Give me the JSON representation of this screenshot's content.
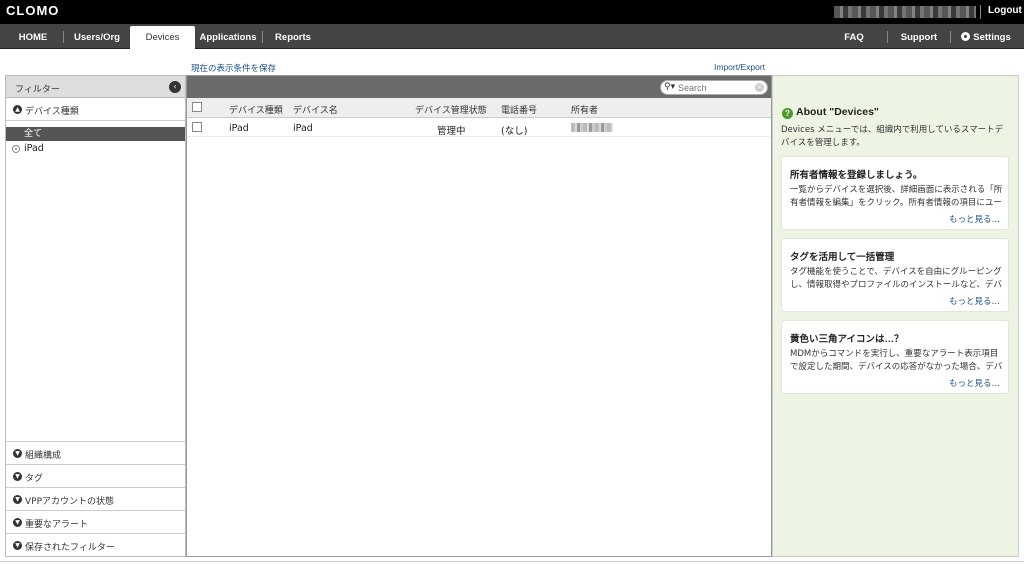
{
  "app": {
    "logo": "CLOMO",
    "logout": "Logout"
  },
  "nav": {
    "items": [
      {
        "label": "HOME"
      },
      {
        "label": "Users/Org"
      },
      {
        "label": "Devices",
        "active": true
      },
      {
        "label": "Applications"
      },
      {
        "label": "Reports"
      }
    ],
    "right": [
      {
        "label": "FAQ"
      },
      {
        "label": "Support"
      },
      {
        "label": "Settings",
        "icon": "gear-icon"
      }
    ]
  },
  "links": {
    "save_view": "現在の表示条件を保存",
    "import_export": "Import/Export"
  },
  "filter": {
    "title": "フィルター",
    "device_type_label": "デバイス種類",
    "options": [
      {
        "label": "全て",
        "selected": true
      },
      {
        "label": "iPad"
      }
    ],
    "sections": [
      {
        "label": "組織構成"
      },
      {
        "label": "タグ"
      },
      {
        "label": "VPPアカウントの状態"
      },
      {
        "label": "重要なアラート"
      },
      {
        "label": "保存されたフィルター"
      }
    ]
  },
  "table": {
    "search_placeholder": "Search",
    "columns": [
      "デバイス種類",
      "デバイス名",
      "デバイス管理状態",
      "電話番号",
      "所有者"
    ],
    "rows": [
      {
        "type": "iPad",
        "name": "iPad",
        "status": "管理中",
        "phone": "(なし)"
      }
    ]
  },
  "help": {
    "title": "About \"Devices\"",
    "description": "Devices メニューでは、組織内で利用しているスマートデバイスを管理します。",
    "cards": [
      {
        "title": "所有者情報を登録しましょう。",
        "body": "一覧からデバイスを選択後、詳細画面に表示される「所有者情報を編集」をクリック。所有者情報の項目にユー",
        "more": "もっと見る…"
      },
      {
        "title": "タグを活用して一括管理",
        "body": "タグ機能を使うことで、デバイスを自由にグルーピングし、情報取得やプロファイルのインストールなど、デバ",
        "more": "もっと見る…"
      },
      {
        "title": "黄色い三角アイコンは…？",
        "body": "MDMからコマンドを実行し、重要なアラート表示項目で設定した期間、デバイスの応答がなかった場合、デバ",
        "more": "もっと見る…"
      }
    ]
  },
  "colors": {
    "topbar": "#000000",
    "nav": "#444444",
    "help_bg": "#eef4e4",
    "link": "#1a4f8a",
    "help_icon": "#4a9a2a"
  }
}
